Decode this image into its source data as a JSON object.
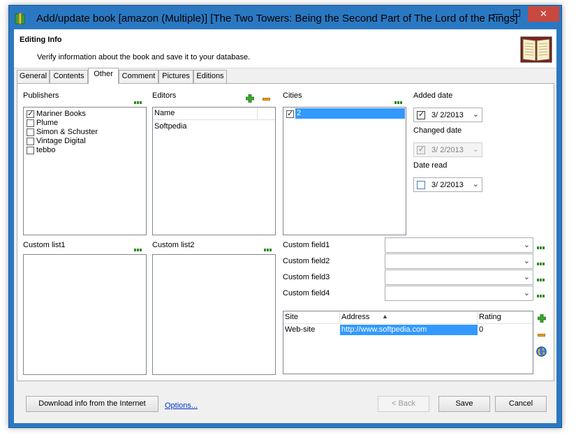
{
  "window": {
    "title": "Add/update book [amazon (Multiple)] [The Two Towers: Being the Second Part of The Lord of the Rings]",
    "min_symbol": "—",
    "max_symbol": "☐",
    "close_symbol": "✕"
  },
  "header": {
    "title": "Editing Info",
    "description": "Verify information about the book and save it to your database.",
    "icon": "book-icon"
  },
  "tabs": [
    {
      "label": "General"
    },
    {
      "label": "Contents"
    },
    {
      "label": "Other",
      "active": true
    },
    {
      "label": "Comment"
    },
    {
      "label": "Pictures"
    },
    {
      "label": "Editions"
    }
  ],
  "publishers": {
    "label": "Publishers",
    "items": [
      {
        "label": "Mariner Books",
        "checked": true
      },
      {
        "label": "Plume",
        "checked": false
      },
      {
        "label": "Simon & Schuster",
        "checked": false
      },
      {
        "label": "Vintage Digital",
        "checked": false
      },
      {
        "label": "tebbo",
        "checked": false
      }
    ]
  },
  "editors": {
    "label": "Editors",
    "column": "Name",
    "rows": [
      "Softpedia"
    ]
  },
  "cities": {
    "label": "Cities",
    "items": [
      {
        "label": "2",
        "checked": true,
        "selected": true
      }
    ]
  },
  "dates": {
    "added": {
      "label": "Added date",
      "value": "3/  2/2013",
      "checked": true,
      "enabled": true
    },
    "changed": {
      "label": "Changed date",
      "value": "3/  2/2013",
      "checked": true,
      "enabled": false
    },
    "read": {
      "label": "Date read",
      "value": "3/  2/2013",
      "checked": false,
      "enabled": true
    }
  },
  "custom_lists": [
    {
      "label": "Custom list1"
    },
    {
      "label": "Custom list2"
    }
  ],
  "custom_fields": [
    {
      "label": "Custom field1",
      "value": ""
    },
    {
      "label": "Custom field2",
      "value": ""
    },
    {
      "label": "Custom field3",
      "value": ""
    },
    {
      "label": "Custom field4",
      "value": ""
    }
  ],
  "links_grid": {
    "columns": [
      "Site",
      "Address",
      "Rating"
    ],
    "rows": [
      {
        "site": "Web-site",
        "address": "http://www.softpedia.com",
        "rating": "0"
      }
    ]
  },
  "buttons": {
    "download": "Download info from the Internet",
    "options": "Options...",
    "back": "< Back",
    "save": "Save",
    "cancel": "Cancel"
  },
  "colors": {
    "frame": "#2b78c2",
    "close": "#c9483e",
    "selection": "#3399ff",
    "accent_green": "#2e8b1f"
  }
}
